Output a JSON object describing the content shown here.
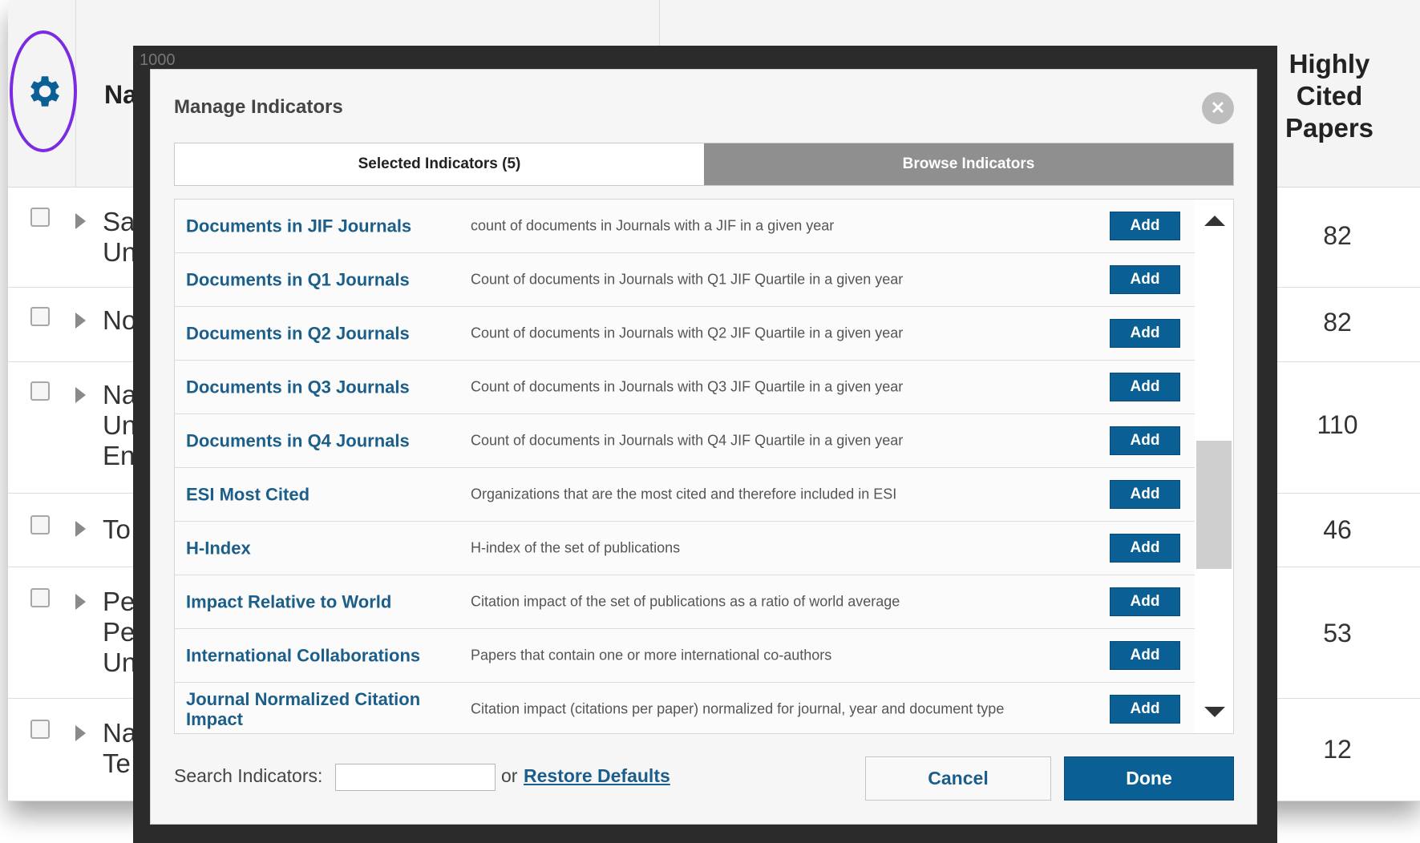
{
  "background": {
    "header": {
      "name_col": "Na",
      "hcp_col": "Highly Cited Papers"
    },
    "axis_label": "1000",
    "rows": [
      {
        "name": "Sa\nUn",
        "hcp": "82"
      },
      {
        "name": "No",
        "hcp": "82"
      },
      {
        "name": "Na\nUn\nEn",
        "hcp": "110"
      },
      {
        "name": "To",
        "hcp": "46"
      },
      {
        "name": "Pe\nPe\nUn",
        "hcp": "53"
      },
      {
        "name": "Na\nTe",
        "hcp": "12"
      }
    ]
  },
  "modal": {
    "title": "Manage Indicators",
    "tabs": {
      "selected": "Selected Indicators (5)",
      "browse": "Browse Indicators"
    },
    "add_label": "Add",
    "indicators": [
      {
        "name": "Documents in JIF Journals",
        "description": "count of documents in Journals with a JIF in a given year"
      },
      {
        "name": "Documents in Q1 Journals",
        "description": "Count of documents in Journals with Q1 JIF Quartile in a given year"
      },
      {
        "name": "Documents in Q2 Journals",
        "description": "Count of documents in Journals with Q2 JIF Quartile in a given year"
      },
      {
        "name": "Documents in Q3 Journals",
        "description": "Count of documents in Journals with Q3 JIF Quartile in a given year"
      },
      {
        "name": "Documents in Q4 Journals",
        "description": "Count of documents in Journals with Q4 JIF Quartile in a given year"
      },
      {
        "name": "ESI Most Cited",
        "description": "Organizations that are the most cited and therefore included in ESI"
      },
      {
        "name": "H-Index",
        "description": "H-index of the set of publications"
      },
      {
        "name": "Impact Relative to World",
        "description": "Citation impact of the set of publications as a ratio of world average"
      },
      {
        "name": "International Collaborations",
        "description": "Papers that contain one or more international co-authors"
      },
      {
        "name": "Journal Normalized Citation Impact",
        "description": "Citation impact (citations per paper) normalized for journal, year and document type"
      }
    ],
    "footer": {
      "search_label": "Search Indicators:",
      "search_value": "",
      "or_text": "or",
      "restore_label": "Restore Defaults",
      "cancel_label": "Cancel",
      "done_label": "Done"
    }
  },
  "colors": {
    "accent": "#0a5f95",
    "link": "#1b5e8a",
    "highlight_ring": "#7b2be0",
    "gear": "#0a5f95"
  },
  "icons": [
    "gear-icon",
    "close-icon",
    "chevron-up-icon",
    "chevron-down-icon",
    "caret-right-icon"
  ]
}
